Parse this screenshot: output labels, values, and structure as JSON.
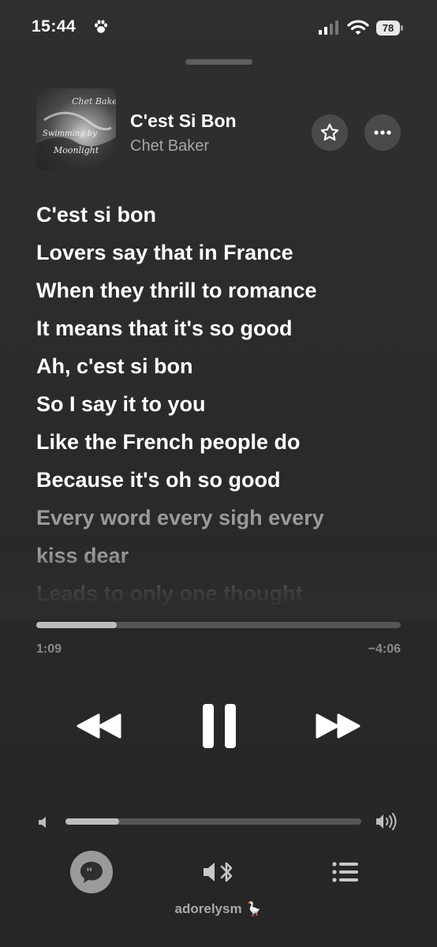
{
  "status_bar": {
    "time": "15:44",
    "battery": "78"
  },
  "now_playing": {
    "title": "C'est Si Bon",
    "artist": "Chet Baker",
    "artwork_text": "Chet Baker Swimming by Moonlight"
  },
  "lyrics": [
    {
      "text": "C'est si bon",
      "active": true
    },
    {
      "text": "Lovers say that in France",
      "active": true
    },
    {
      "text": "When they thrill to romance",
      "active": true
    },
    {
      "text": "It means that it's so good",
      "active": true
    },
    {
      "text": "Ah, c'est si bon",
      "active": true
    },
    {
      "text": "So I say it to you",
      "active": true
    },
    {
      "text": "Like the French people do",
      "active": true
    },
    {
      "text": "Because it's oh so good",
      "active": true
    },
    {
      "text": "Every word every sigh every",
      "active": false
    },
    {
      "text": "kiss dear",
      "active": false
    },
    {
      "text": "Leads to only one thought",
      "active": false
    }
  ],
  "playback": {
    "elapsed": "1:09",
    "remaining": "−4:06",
    "progress_fraction": 0.22,
    "state": "playing"
  },
  "volume": {
    "level_fraction": 0.18
  },
  "icons": {
    "status": [
      "paw-icon",
      "signal-icon",
      "wifi-icon",
      "battery-icon"
    ],
    "header": [
      "star-icon",
      "more-icon"
    ],
    "controls": [
      "rewind-icon",
      "pause-icon",
      "fast-forward-icon"
    ],
    "volume": [
      "speaker-low-icon",
      "speaker-high-icon"
    ],
    "bottom": [
      "lyrics-icon",
      "airplay-bluetooth-icon",
      "queue-icon"
    ]
  },
  "colors": {
    "background": "#2b2b2b",
    "accent_fill": "#bdbdbd",
    "track": "#555555",
    "dim_text": "#9a9a9a"
  },
  "watermark": "adorelysm 🪿"
}
